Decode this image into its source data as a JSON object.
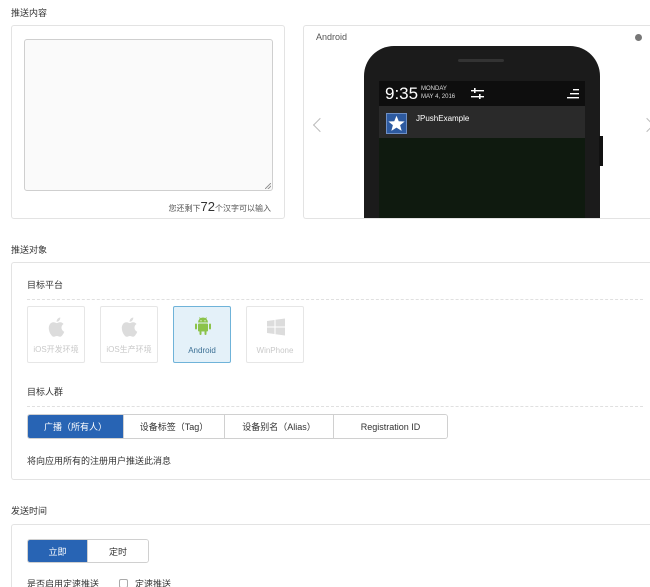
{
  "sections": {
    "content_title": "推送内容",
    "target_title": "推送对象",
    "time_title": "发送时间"
  },
  "content": {
    "textarea_value": "",
    "count_prefix": "您还剩下",
    "count_number": "72",
    "count_suffix": "个汉字可以输入"
  },
  "preview": {
    "title": "Android",
    "clock": "9:35",
    "date_day": "MONDAY",
    "date_full": "MAY 4, 2016",
    "app_name": "JPushExample"
  },
  "target": {
    "platform_label": "目标平台",
    "platforms": [
      {
        "label": "iOS开发环境",
        "icon": "apple-icon",
        "selected": false
      },
      {
        "label": "iOS生产环境",
        "icon": "apple-icon",
        "selected": false
      },
      {
        "label": "Android",
        "icon": "android-icon",
        "selected": true
      },
      {
        "label": "WinPhone",
        "icon": "windows-icon",
        "selected": false
      }
    ],
    "audience_label": "目标人群",
    "audience_tabs": [
      "广播（所有人）",
      "设备标签（Tag）",
      "设备别名（Alias）",
      "Registration ID"
    ],
    "audience_selected": 0,
    "note": "将向应用所有的注册用户推送此消息"
  },
  "time": {
    "tabs": [
      "立即",
      "定时"
    ],
    "selected": 0,
    "speed_label": "是否启用定速推送",
    "speed_checkbox_label": "定速推送",
    "speed_checked": false
  },
  "colors": {
    "accent": "#2864b4",
    "android_green": "#8bc34a",
    "selected_bg": "#e4f1f9"
  }
}
